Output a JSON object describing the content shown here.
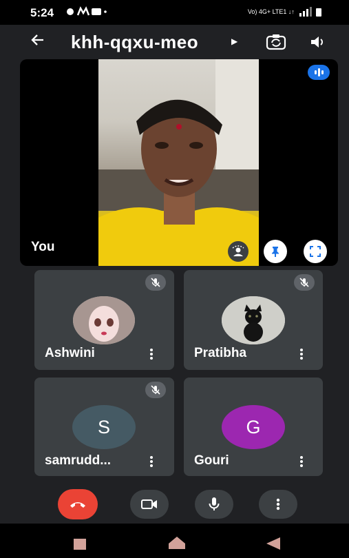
{
  "status_bar": {
    "time": "5:24",
    "network_text": "Vo) 4G+ LTE1 ↓↑"
  },
  "header": {
    "meeting_code": "khh-qqxu-meo"
  },
  "main_tile": {
    "label": "You"
  },
  "participants": [
    {
      "name": "Ashwini",
      "muted": true,
      "avatar": "photo"
    },
    {
      "name": "Pratibha",
      "muted": true,
      "avatar": "photo"
    },
    {
      "name": "samrudd...",
      "muted": true,
      "avatar": "S",
      "avatar_color": "#455a64"
    },
    {
      "name": "Gouri",
      "muted": false,
      "avatar": "G",
      "avatar_color": "#9c27b0"
    }
  ],
  "colors": {
    "end_call": "#ea4335",
    "speaking_indicator": "#1a73e8",
    "tile_bg": "#3c4043",
    "control_bg": "#3c4043"
  },
  "icons": [
    "back-arrow-icon",
    "switch-camera-icon",
    "speaker-icon",
    "audio-level-icon",
    "camera-effects-icon",
    "pin-icon",
    "fullscreen-icon",
    "mic-off-icon",
    "more-vert-icon",
    "end-call-icon",
    "camera-icon",
    "mic-icon",
    "recent-apps-icon",
    "home-icon",
    "back-nav-icon"
  ]
}
